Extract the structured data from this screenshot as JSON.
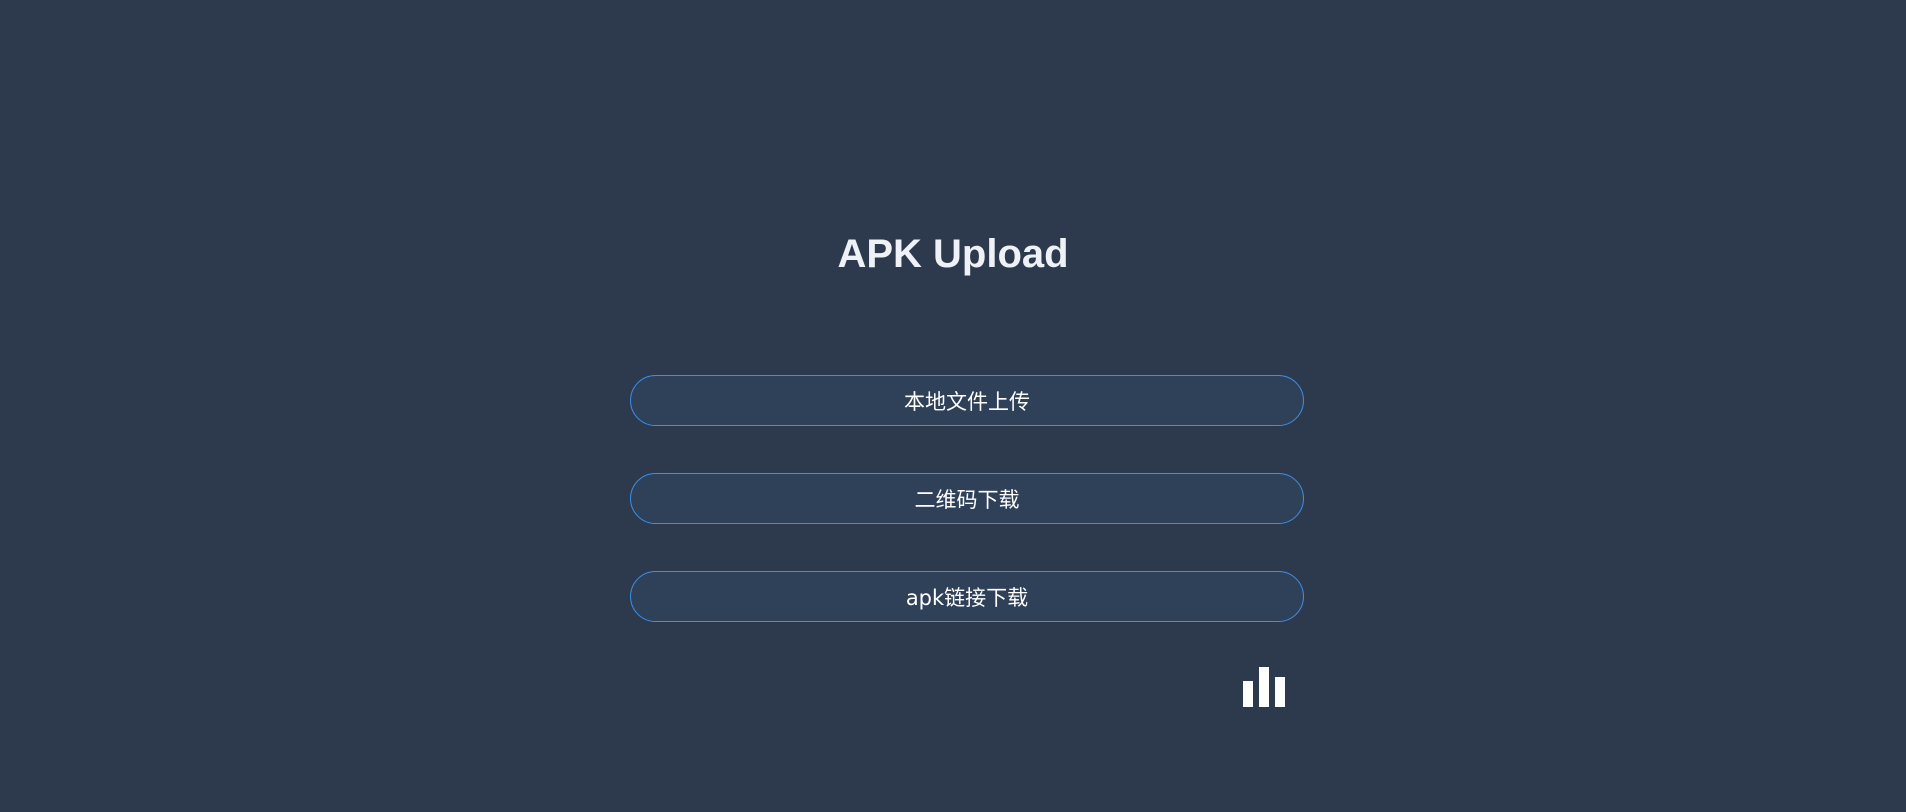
{
  "page": {
    "title": "APK Upload"
  },
  "actions": [
    {
      "label": "本地文件上传"
    },
    {
      "label": "二维码下载"
    },
    {
      "label": "apk链接下载"
    }
  ],
  "stats": {
    "icon": "bar-chart-icon"
  },
  "colors": {
    "background": "#2d3a4e",
    "button_fill": "#2f4159",
    "button_border": "#3d8fe8",
    "text": "#ffffff"
  }
}
